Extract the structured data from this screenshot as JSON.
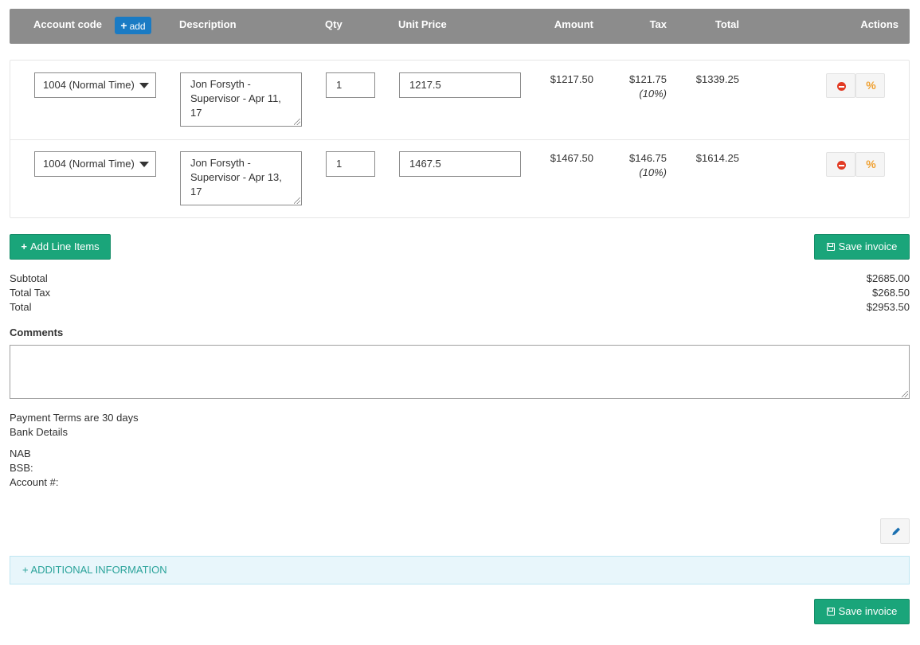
{
  "header": {
    "account_code": "Account code",
    "add_label": "add",
    "description": "Description",
    "qty": "Qty",
    "unit_price": "Unit Price",
    "amount": "Amount",
    "tax": "Tax",
    "total": "Total",
    "actions": "Actions",
    "bg_color": "#8c8c8c"
  },
  "items": [
    {
      "account": "1004 (Normal Time)",
      "description_lines": [
        "Jon Forsyth -",
        "Supervisor - Apr 11,",
        "17"
      ],
      "qty": "1",
      "unit_price": "1217.5",
      "amount": "$1217.50",
      "tax": "$121.75",
      "tax_rate": "(10%)",
      "total": "$1339.25"
    },
    {
      "account": "1004 (Normal Time)",
      "description_lines": [
        "Jon Forsyth -",
        "Supervisor - Apr 13,",
        "17"
      ],
      "qty": "1",
      "unit_price": "1467.5",
      "amount": "$1467.50",
      "tax": "$146.75",
      "tax_rate": "(10%)",
      "total": "$1614.25"
    }
  ],
  "buttons": {
    "add_line_items": "Add Line Items",
    "save_invoice": "Save invoice",
    "save_invoice_bottom": "Save invoice",
    "green_color": "#1aa57a"
  },
  "summary": {
    "subtotal_label": "Subtotal",
    "subtotal_value": "$2685.00",
    "tax_label": "Total Tax",
    "tax_value": "$268.50",
    "total_label": "Total",
    "total_value": "$2953.50"
  },
  "comments": {
    "label": "Comments",
    "value": ""
  },
  "terms": {
    "payment_terms": "Payment Terms are 30 days",
    "bank_details": "Bank Details",
    "bank": "NAB",
    "bsb": "BSB:",
    "account": "Account #:"
  },
  "additional_info": "+ ADDITIONAL INFORMATION",
  "icons": {
    "delete": "minus-circle-icon",
    "discount": "percent-icon",
    "edit": "pencil-icon",
    "save": "floppy-disk-icon",
    "add": "plus-icon"
  }
}
